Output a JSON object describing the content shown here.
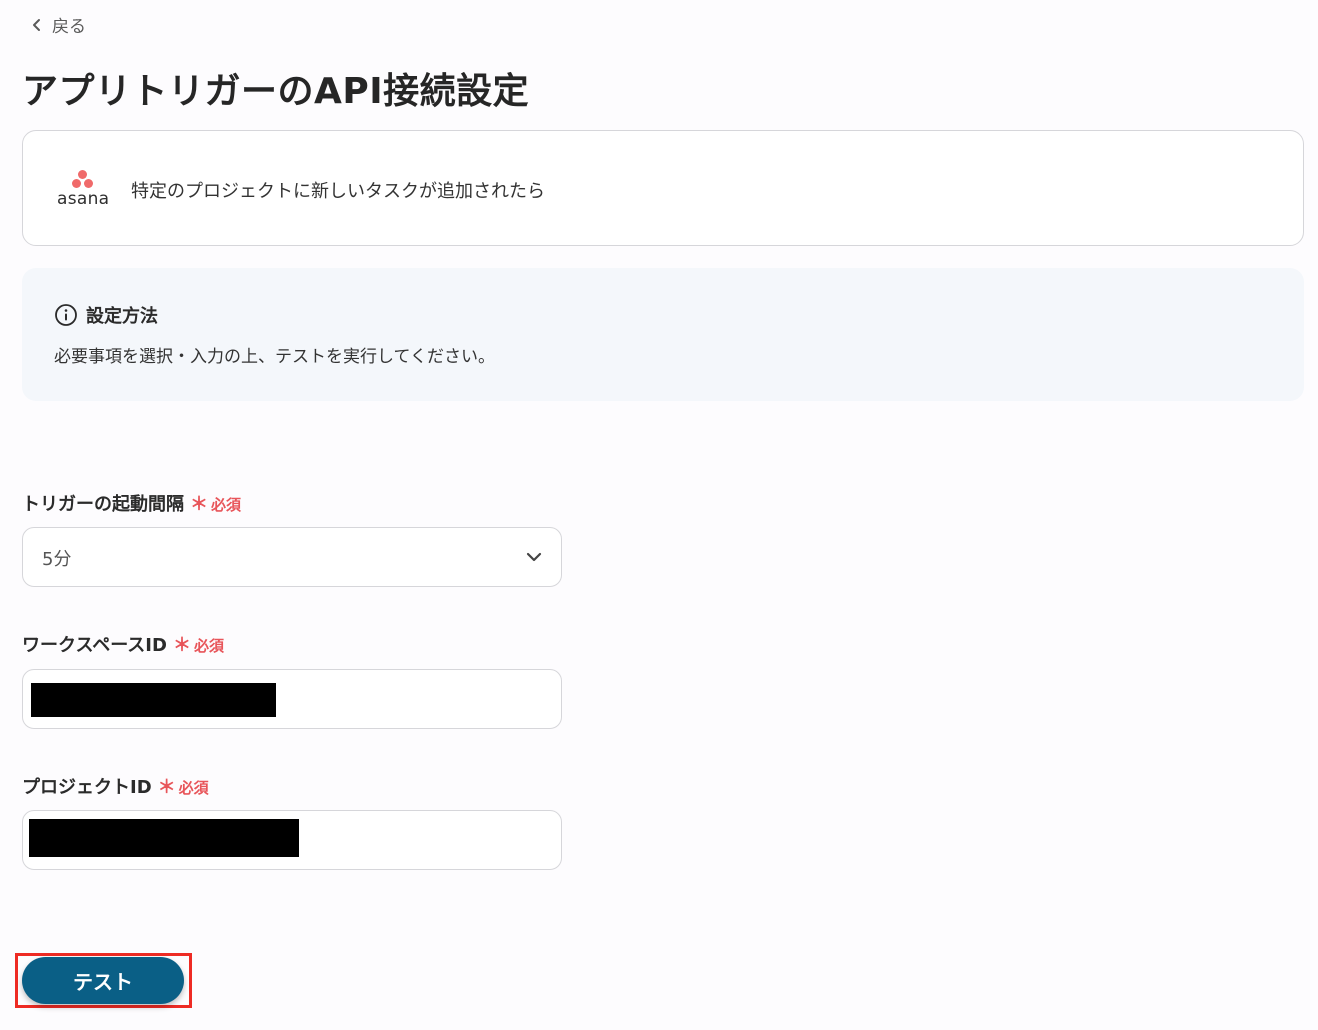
{
  "nav": {
    "back_label": "戻る"
  },
  "page": {
    "title": "アプリトリガーのAPI接続設定"
  },
  "trigger": {
    "app_name": "asana",
    "description": "特定のプロジェクトに新しいタスクが追加されたら"
  },
  "info": {
    "heading": "設定方法",
    "body": "必要事項を選択・入力の上、テストを実行してください。"
  },
  "fields": {
    "interval": {
      "label": "トリガーの起動間隔",
      "required_mark": "＊",
      "required_text": "必須",
      "value": "5分"
    },
    "workspace": {
      "label": "ワークスペースID",
      "required_mark": "＊",
      "required_text": "必須",
      "value": "[redacted]"
    },
    "project": {
      "label": "プロジェクトID",
      "required_mark": "＊",
      "required_text": "必須",
      "value": "[redacted]"
    }
  },
  "actions": {
    "test_label": "テスト"
  },
  "colors": {
    "accent": "#0a5f86",
    "required": "#e8555a",
    "highlight": "#ee2b24",
    "asana": "#f06a6a",
    "info_bg": "#f4f7fb"
  },
  "icons": [
    "chevron-left-icon",
    "asana-logo",
    "info-icon",
    "chevron-down-icon"
  ]
}
